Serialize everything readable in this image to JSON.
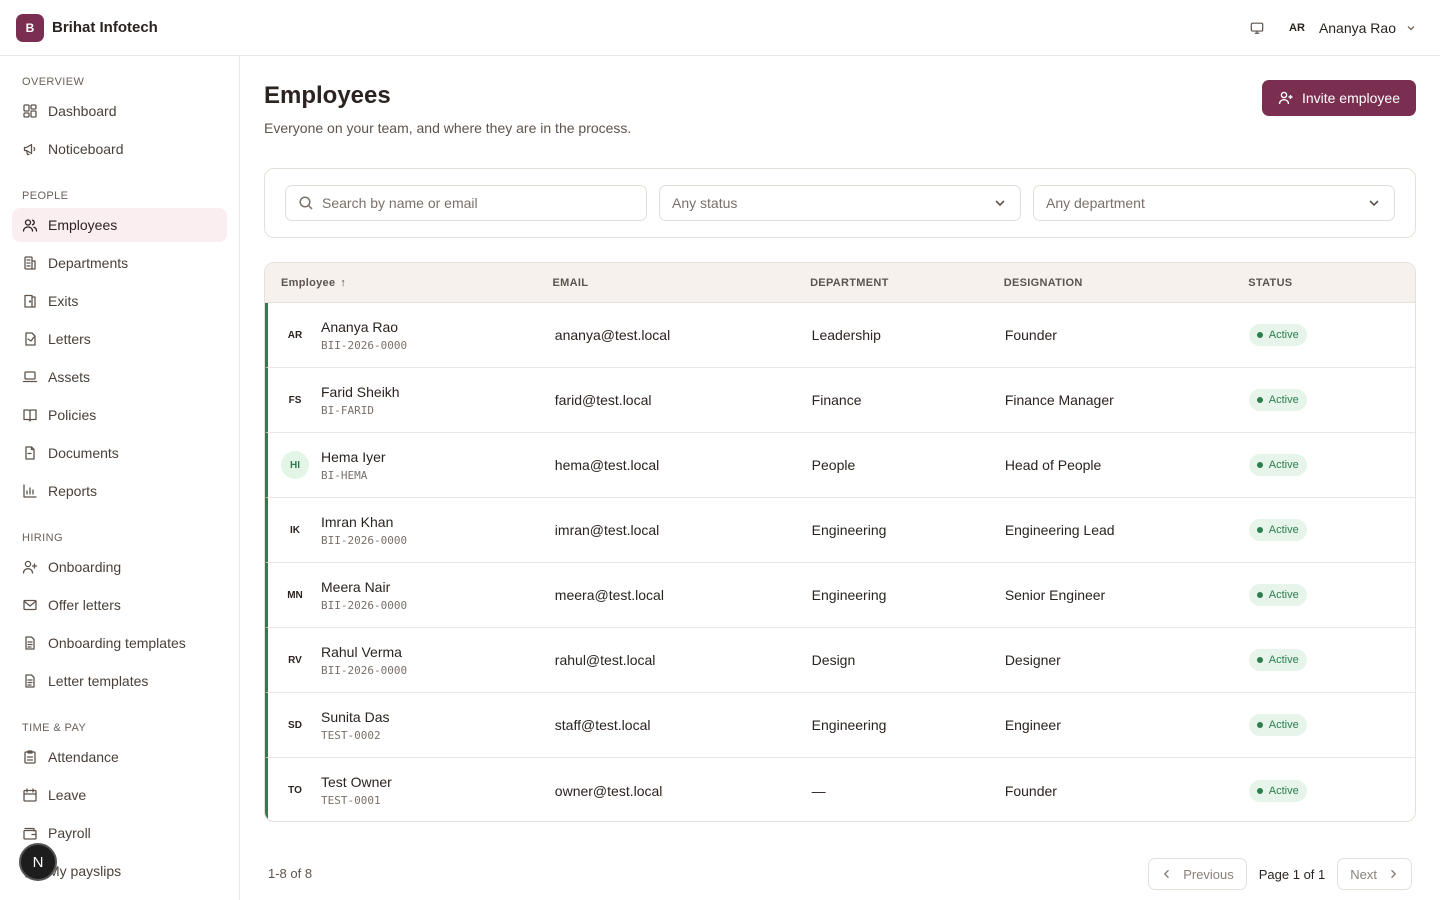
{
  "app": {
    "logo_letter": "B",
    "brand": "Brihat Infotech"
  },
  "user": {
    "initials": "AR",
    "name": "Ananya Rao"
  },
  "sidebar": {
    "sections": [
      {
        "label": "OVERVIEW",
        "items": [
          {
            "label": "Dashboard",
            "icon": "dashboard-icon"
          },
          {
            "label": "Noticeboard",
            "icon": "megaphone-icon"
          }
        ]
      },
      {
        "label": "PEOPLE",
        "items": [
          {
            "label": "Employees",
            "icon": "users-icon",
            "active": true
          },
          {
            "label": "Departments",
            "icon": "building-icon"
          },
          {
            "label": "Exits",
            "icon": "door-icon"
          },
          {
            "label": "Letters",
            "icon": "letter-icon"
          },
          {
            "label": "Assets",
            "icon": "laptop-icon"
          },
          {
            "label": "Policies",
            "icon": "book-icon"
          },
          {
            "label": "Documents",
            "icon": "file-icon"
          },
          {
            "label": "Reports",
            "icon": "bar-chart-icon"
          }
        ]
      },
      {
        "label": "HIRING",
        "items": [
          {
            "label": "Onboarding",
            "icon": "user-plus-icon"
          },
          {
            "label": "Offer letters",
            "icon": "mail-icon"
          },
          {
            "label": "Onboarding templates",
            "icon": "file-text-icon"
          },
          {
            "label": "Letter templates",
            "icon": "file-text-icon"
          }
        ]
      },
      {
        "label": "TIME & PAY",
        "items": [
          {
            "label": "Attendance",
            "icon": "clipboard-icon"
          },
          {
            "label": "Leave",
            "icon": "calendar-icon"
          },
          {
            "label": "Payroll",
            "icon": "wallet-icon"
          },
          {
            "label": "My payslips",
            "icon": "receipt-icon"
          }
        ]
      }
    ]
  },
  "fab": {
    "letter": "N"
  },
  "page": {
    "title": "Employees",
    "subtitle": "Everyone on your team, and where they are in the process.",
    "invite_label": "Invite employee"
  },
  "filters": {
    "search_placeholder": "Search by name or email",
    "status_value": "Any status",
    "department_value": "Any department"
  },
  "table": {
    "headers": {
      "employee": "Employee",
      "sort_arrow": "↑",
      "email": "EMAIL",
      "department": "DEPARTMENT",
      "designation": "DESIGNATION",
      "status": "STATUS"
    },
    "rows": [
      {
        "initials": "AR",
        "name": "Ananya Rao",
        "code": "BII-2026-0000",
        "email": "ananya@test.local",
        "department": "Leadership",
        "designation": "Founder",
        "status": "Active",
        "avatar_style": "plain"
      },
      {
        "initials": "FS",
        "name": "Farid Sheikh",
        "code": "BI-FARID",
        "email": "farid@test.local",
        "department": "Finance",
        "designation": "Finance Manager",
        "status": "Active",
        "avatar_style": "plain"
      },
      {
        "initials": "HI",
        "name": "Hema Iyer",
        "code": "BI-HEMA",
        "email": "hema@test.local",
        "department": "People",
        "designation": "Head of People",
        "status": "Active",
        "avatar_style": "green"
      },
      {
        "initials": "IK",
        "name": "Imran Khan",
        "code": "BII-2026-0000",
        "email": "imran@test.local",
        "department": "Engineering",
        "designation": "Engineering Lead",
        "status": "Active",
        "avatar_style": "plain"
      },
      {
        "initials": "MN",
        "name": "Meera Nair",
        "code": "BII-2026-0000",
        "email": "meera@test.local",
        "department": "Engineering",
        "designation": "Senior Engineer",
        "status": "Active",
        "avatar_style": "plain"
      },
      {
        "initials": "RV",
        "name": "Rahul Verma",
        "code": "BII-2026-0000",
        "email": "rahul@test.local",
        "department": "Design",
        "designation": "Designer",
        "status": "Active",
        "avatar_style": "plain"
      },
      {
        "initials": "SD",
        "name": "Sunita Das",
        "code": "TEST-0002",
        "email": "staff@test.local",
        "department": "Engineering",
        "designation": "Engineer",
        "status": "Active",
        "avatar_style": "plain"
      },
      {
        "initials": "TO",
        "name": "Test Owner",
        "code": "TEST-0001",
        "email": "owner@test.local",
        "department": "—",
        "designation": "Founder",
        "status": "Active",
        "avatar_style": "plain"
      }
    ]
  },
  "pagination": {
    "count": "1-8 of 8",
    "previous": "Previous",
    "page_info": "Page 1 of 1",
    "next": "Next"
  },
  "colors": {
    "brand": "#7a2e50",
    "active_nav_bg": "#fbeef1",
    "status_green": "#2e7d4f",
    "badge_bg": "#e6f4ea",
    "header_bg": "#f6f1ec"
  }
}
